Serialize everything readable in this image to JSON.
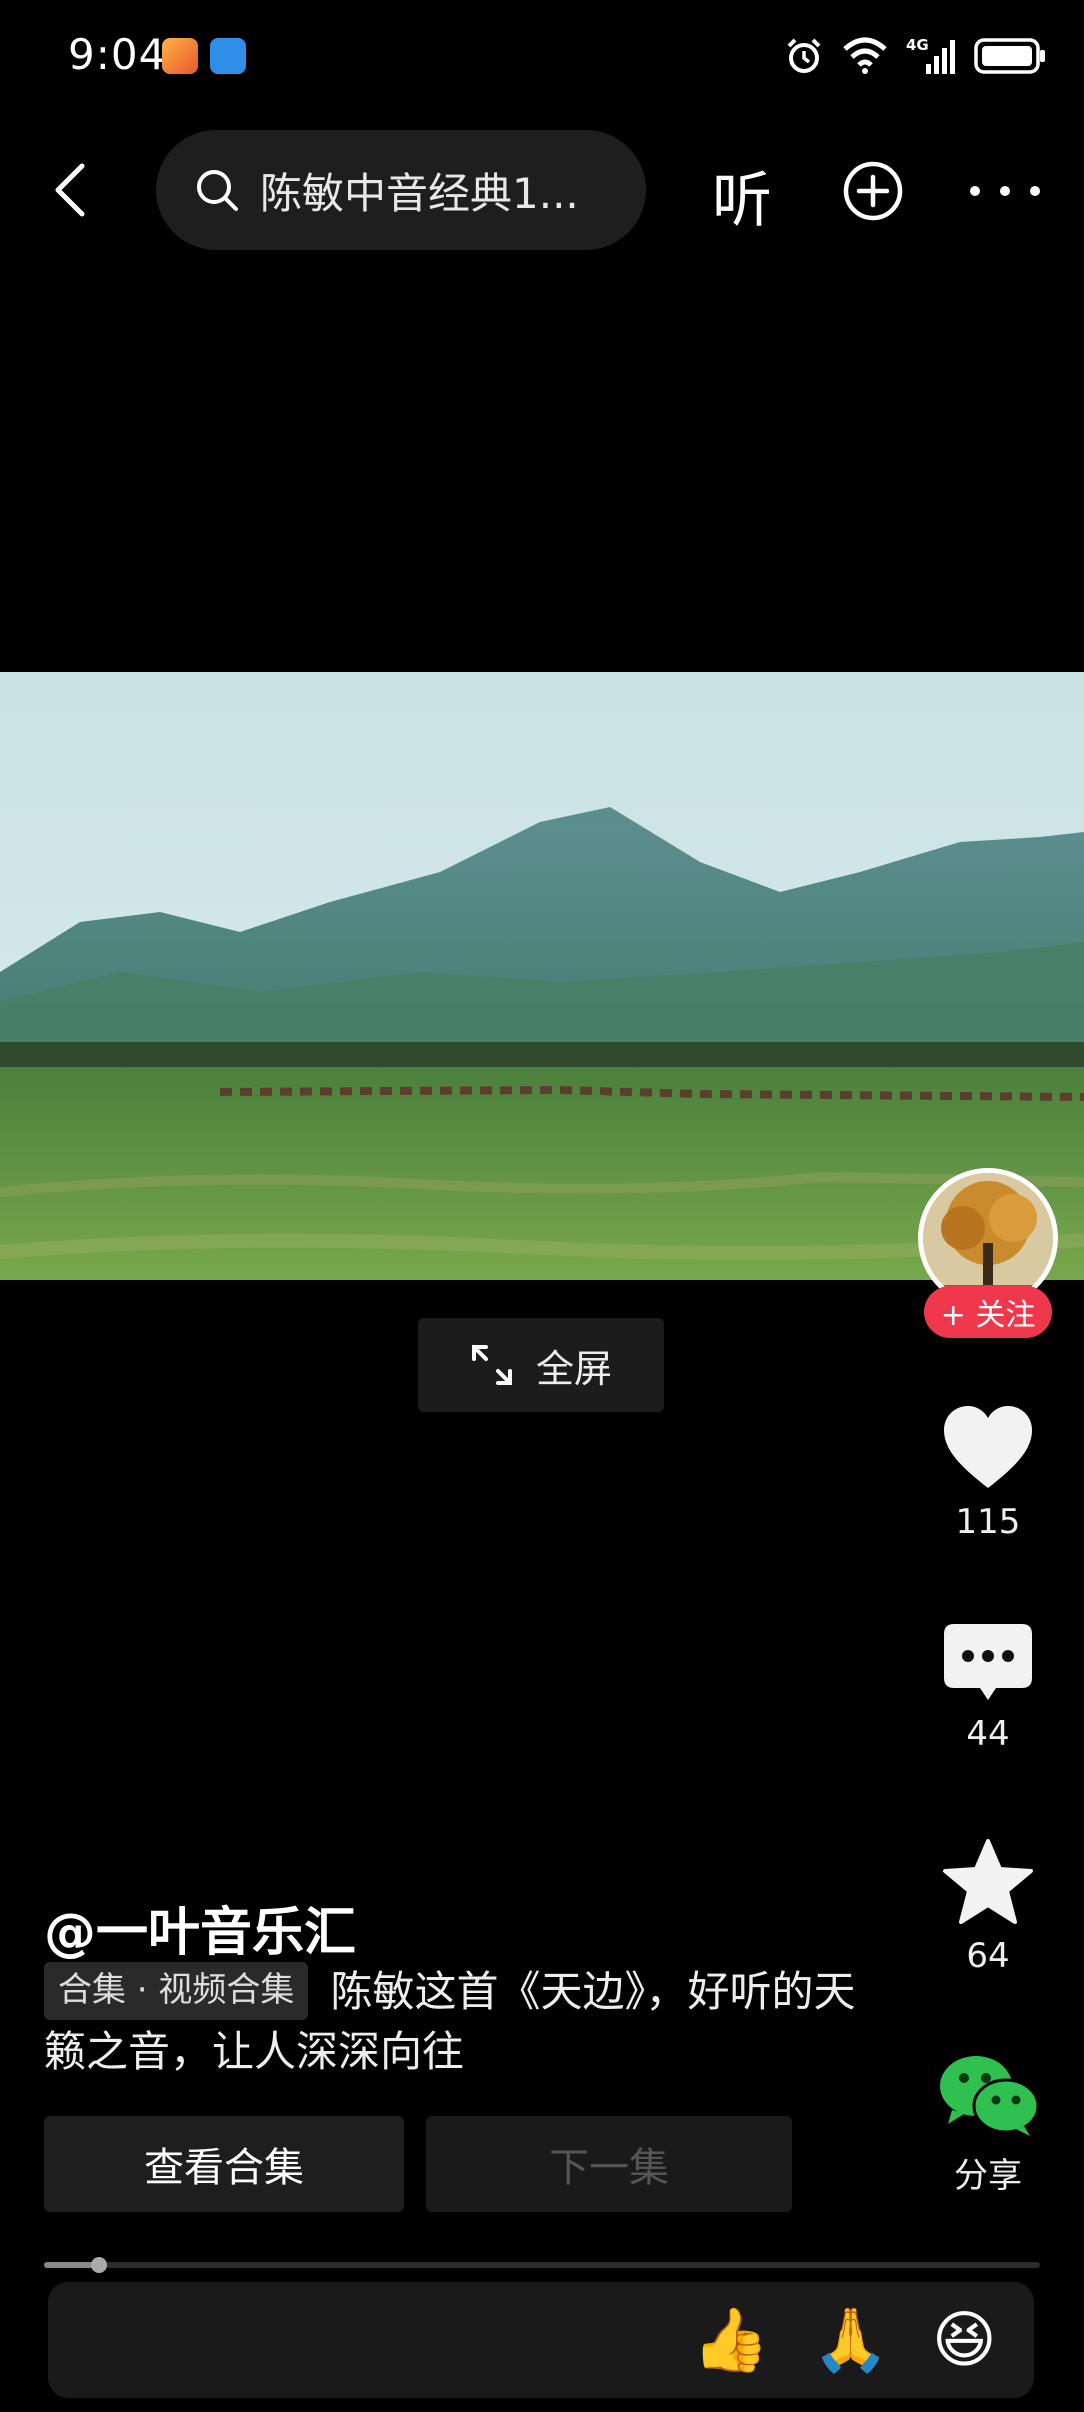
{
  "status_bar": {
    "time": "9:04",
    "network": "4G",
    "icons": [
      "app-badge-icon",
      "browser-icon",
      "alarm-icon",
      "wifi-icon",
      "signal-icon",
      "battery-icon"
    ]
  },
  "top_nav": {
    "search_text": "陈敏中音经典1...",
    "listen_label": "听"
  },
  "video": {
    "fullscreen_label": "全屏"
  },
  "right_rail": {
    "follow_label": "+ 关注",
    "likes": "115",
    "comments": "44",
    "favorites": "64",
    "share_label": "分享"
  },
  "post": {
    "author": "@一叶音乐汇",
    "collection_tag": "合集 · 视频合集",
    "caption": "陈敏这首《天边》，好听的天籁之音，让人深深向往",
    "view_collection_label": "查看合集",
    "next_episode_label": "下一集"
  },
  "player": {
    "progress_fraction": 0.055
  },
  "comment_bar": {
    "placeholder": "",
    "emojis": [
      "👍",
      "🙏",
      "😆"
    ]
  },
  "colors": {
    "accent_follow": "#f0384c",
    "wechat_green": "#2fc04f",
    "background": "#000000"
  }
}
